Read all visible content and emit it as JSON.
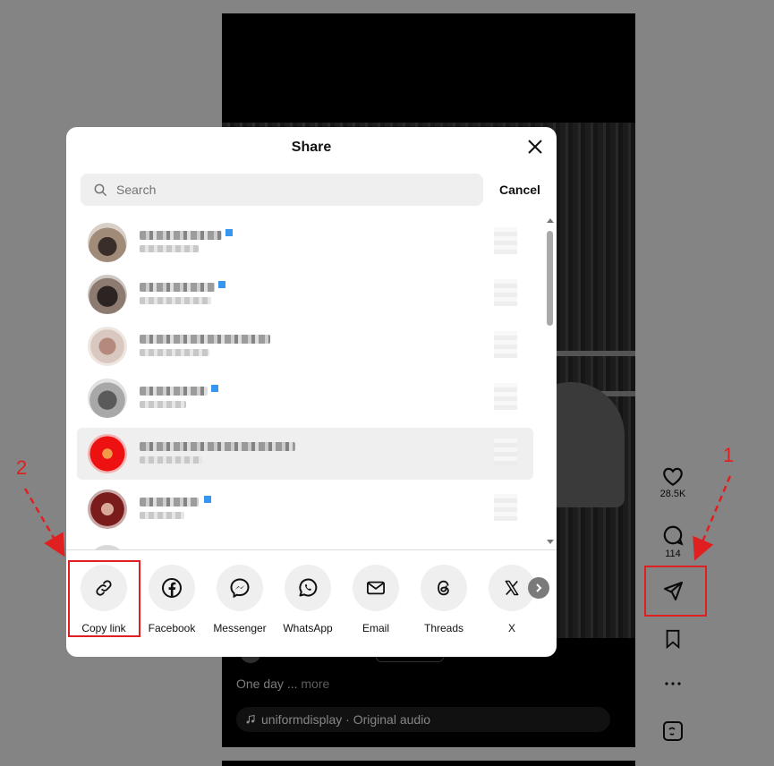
{
  "modal": {
    "title": "Share",
    "search_placeholder": "Search",
    "cancel_label": "Cancel"
  },
  "share_options": [
    {
      "label": "Copy link",
      "icon": "link-icon"
    },
    {
      "label": "Facebook",
      "icon": "facebook-icon"
    },
    {
      "label": "Messenger",
      "icon": "messenger-icon"
    },
    {
      "label": "WhatsApp",
      "icon": "whatsapp-icon"
    },
    {
      "label": "Email",
      "icon": "email-icon"
    },
    {
      "label": "Threads",
      "icon": "threads-icon"
    },
    {
      "label": "X",
      "icon": "x-icon"
    }
  ],
  "contacts_note": "blurred",
  "reel": {
    "caption": "One day ...",
    "more_label": "more",
    "audio": "uniformdisplay · Original audio"
  },
  "actions": {
    "likes": "28.5K",
    "comments": "114"
  },
  "annotations": {
    "step1": "1",
    "step2": "2"
  },
  "colors": {
    "annotation": "#e02020",
    "verified": "#3797f0"
  }
}
